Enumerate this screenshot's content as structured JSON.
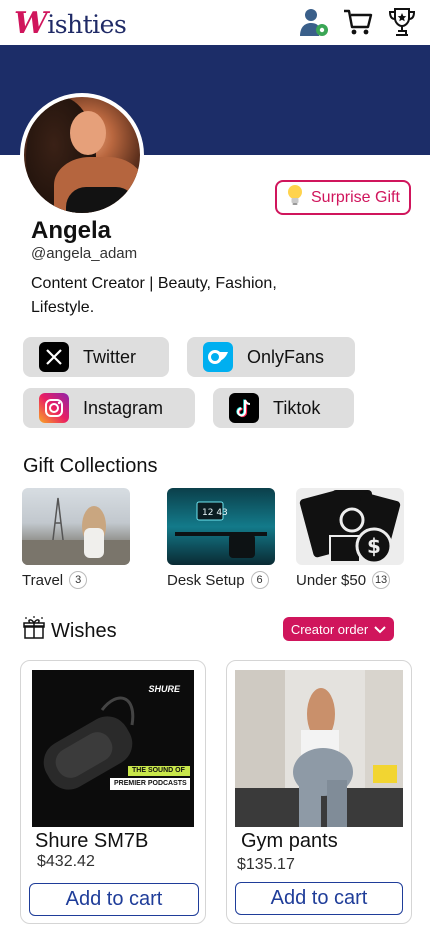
{
  "app": {
    "logo_text": "ishties",
    "logo_initial": "W"
  },
  "header": {
    "icons": [
      "user-settings-icon",
      "cart-icon",
      "trophy-icon"
    ]
  },
  "profile": {
    "name": "Angela",
    "handle": "@angela_adam",
    "bio": "Content Creator | Beauty, Fashion, Lifestyle.",
    "surprise_gift_label": "Surprise Gift"
  },
  "socials": [
    {
      "label": "Twitter",
      "icon": "x-twitter-icon"
    },
    {
      "label": "OnlyFans",
      "icon": "onlyfans-icon"
    },
    {
      "label": "Instagram",
      "icon": "instagram-icon"
    },
    {
      "label": "Tiktok",
      "icon": "tiktok-icon"
    }
  ],
  "collections": {
    "title": "Gift Collections",
    "items": [
      {
        "label": "Travel",
        "count": "3"
      },
      {
        "label": "Desk Setup",
        "count": "6"
      },
      {
        "label": "Under $50",
        "count": "13"
      }
    ]
  },
  "wishes": {
    "title": "Wishes",
    "sort_label": "Creator order",
    "items": [
      {
        "name": "Shure SM7B",
        "price": "$432.42",
        "cta": "Add to cart",
        "img_brand": "SHURE",
        "img_line1": "THE SOUND OF",
        "img_line2": "PREMIER PODCASTS"
      },
      {
        "name": "Gym pants",
        "price": "$135.17",
        "cta": "Add to cart"
      }
    ]
  },
  "colors": {
    "brand": "#d0155c",
    "navy": "#1c2d68",
    "button_blue": "#1f3d99"
  }
}
